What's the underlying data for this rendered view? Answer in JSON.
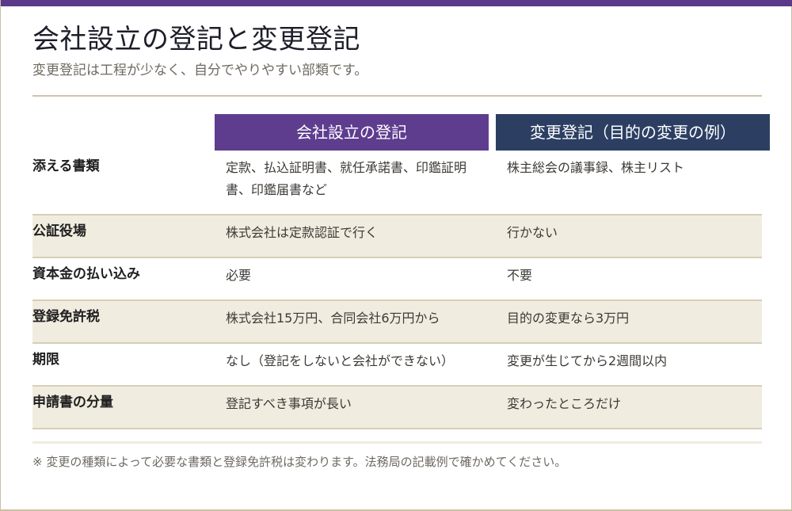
{
  "header": {
    "title": "会社設立の登記と変更登記",
    "subtitle": "変更登記は工程が少なく、自分でやりやすい部類です。"
  },
  "table": {
    "columns": [
      "会社設立の登記",
      "変更登記（目的の変更の例）"
    ],
    "rows": [
      {
        "label": "添える書類",
        "a": "定款、払込証明書、就任承諾書、印鑑証明書、印鑑届書など",
        "b": "株主総会の議事録、株主リスト"
      },
      {
        "label": "公証役場",
        "a": "株式会社は定款認証で行く",
        "b": "行かない"
      },
      {
        "label": "資本金の払い込み",
        "a": "必要",
        "b": "不要"
      },
      {
        "label": "登録免許税",
        "a": "株式会社15万円、合同会社6万円から",
        "b": "目的の変更なら3万円"
      },
      {
        "label": "期限",
        "a": "なし（登記をしないと会社ができない）",
        "b": "変更が生じてから2週間以内"
      },
      {
        "label": "申請書の分量",
        "a": "登記すべき事項が長い",
        "b": "変わったところだけ"
      }
    ]
  },
  "footer": {
    "note": "※ 変更の種類によって必要な書類と登録免許税は変わります。法務局の記載例で確かめてください。"
  },
  "colors": {
    "accent_purple": "#5e3d8f",
    "accent_navy": "#2c3f63",
    "row_shade": "#f1ece0",
    "rule": "#cdc4a8"
  }
}
